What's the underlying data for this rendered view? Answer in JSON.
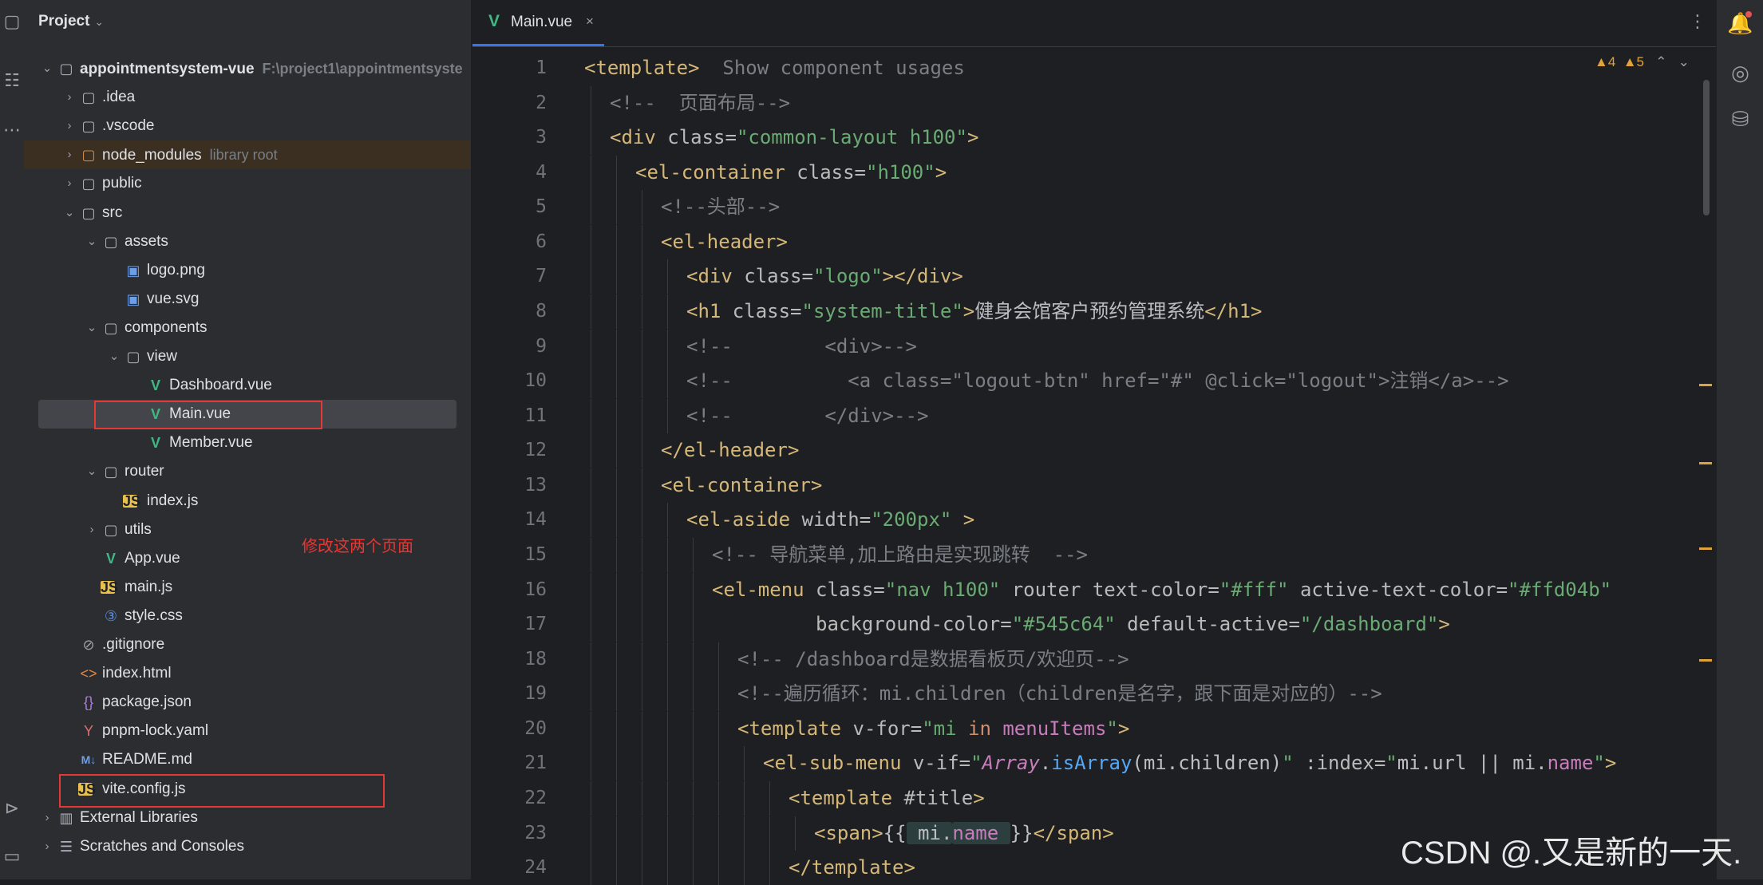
{
  "left_strip": {
    "icons": [
      {
        "name": "project-panel-icon",
        "glyph": "▢"
      },
      {
        "name": "structure-icon",
        "glyph": "☷"
      },
      {
        "name": "more-icon",
        "glyph": "⋯"
      },
      {
        "name": "services-icon",
        "glyph": "⊳"
      },
      {
        "name": "terminal-icon",
        "glyph": "▭"
      }
    ]
  },
  "project": {
    "title": "Project",
    "chevron": "⌄",
    "rows": [
      {
        "arrow": "⌄",
        "icon": "▢",
        "icon_class": "i-folder",
        "label": "appointmentsystem-vue",
        "hint": "F:\\project1\\appointmentsyste",
        "bold": true
      },
      {
        "arrow": "›",
        "icon": "▢",
        "icon_class": "i-folder",
        "label": ".idea"
      },
      {
        "arrow": "›",
        "icon": "▢",
        "icon_class": "i-folder",
        "label": ".vscode"
      },
      {
        "arrow": "›",
        "icon": "▢",
        "icon_class": "i-folder-orange",
        "label": "node_modules",
        "hint": "library root",
        "lib": true
      },
      {
        "arrow": "›",
        "icon": "▢",
        "icon_class": "i-folder",
        "label": "public"
      },
      {
        "arrow": "⌄",
        "icon": "▢",
        "icon_class": "i-folder",
        "label": "src"
      },
      {
        "arrow": "⌄",
        "icon": "▢",
        "icon_class": "i-folder",
        "label": "assets"
      },
      {
        "arrow": "",
        "icon": "▣",
        "icon_class": "i-img",
        "label": "logo.png"
      },
      {
        "arrow": "",
        "icon": "▣",
        "icon_class": "i-img",
        "label": "vue.svg"
      },
      {
        "arrow": "⌄",
        "icon": "▢",
        "icon_class": "i-folder",
        "label": "components"
      },
      {
        "arrow": "⌄",
        "icon": "▢",
        "icon_class": "i-folder",
        "label": "view"
      },
      {
        "arrow": "",
        "icon": "V",
        "icon_class": "i-vue",
        "label": "Dashboard.vue"
      },
      {
        "arrow": "",
        "icon": "V",
        "icon_class": "i-vue",
        "label": "Main.vue",
        "selected": true
      },
      {
        "arrow": "",
        "icon": "V",
        "icon_class": "i-vue",
        "label": "Member.vue"
      },
      {
        "arrow": "⌄",
        "icon": "▢",
        "icon_class": "i-folder",
        "label": "router"
      },
      {
        "arrow": "",
        "icon": "JS",
        "icon_class": "i-js",
        "label": "index.js"
      },
      {
        "arrow": "›",
        "icon": "▢",
        "icon_class": "i-folder",
        "label": "utils"
      },
      {
        "arrow": "",
        "icon": "V",
        "icon_class": "i-vue",
        "label": "App.vue"
      },
      {
        "arrow": "",
        "icon": "JS",
        "icon_class": "i-js",
        "label": "main.js"
      },
      {
        "arrow": "",
        "icon": "③",
        "icon_class": "i-css",
        "label": "style.css"
      },
      {
        "arrow": "",
        "icon": "⊘",
        "icon_class": "i-ignore",
        "label": ".gitignore"
      },
      {
        "arrow": "",
        "icon": "<>",
        "icon_class": "i-html",
        "label": "index.html"
      },
      {
        "arrow": "",
        "icon": "{}",
        "icon_class": "i-json",
        "label": "package.json"
      },
      {
        "arrow": "",
        "icon": "Y",
        "icon_class": "i-yaml",
        "label": "pnpm-lock.yaml"
      },
      {
        "arrow": "",
        "icon": "M↓",
        "icon_class": "i-md",
        "label": "README.md"
      },
      {
        "arrow": "",
        "icon": "JS",
        "icon_class": "i-js",
        "label": "vite.config.js"
      },
      {
        "arrow": "›",
        "icon": "▥",
        "icon_class": "i-lib",
        "label": "External Libraries"
      },
      {
        "arrow": "›",
        "icon": "☰",
        "icon_class": "i-scratch",
        "label": "Scratches and Consoles"
      }
    ],
    "annotation": "修改这两个页面"
  },
  "editor": {
    "tab": {
      "label": "Main.vue",
      "icon": "V",
      "close": "×"
    },
    "more": "⋮",
    "inspections": {
      "warn1": "▲4",
      "warn2": "▲5",
      "up": "⌃",
      "down": "⌄"
    },
    "lines": [
      {
        "n": "1",
        "indent": 0,
        "tokens": [
          [
            "c-tag",
            "<template>"
          ],
          [
            "c-com",
            "  Show component usages"
          ]
        ]
      },
      {
        "n": "2",
        "indent": 1,
        "tokens": [
          [
            "c-com",
            "<!--  页面布局-->"
          ]
        ]
      },
      {
        "n": "3",
        "indent": 1,
        "tokens": [
          [
            "c-tag",
            "<div "
          ],
          [
            "c-attr",
            "class="
          ],
          [
            "c-str",
            "\"common-layout h100\""
          ],
          [
            "c-tag",
            ">"
          ]
        ]
      },
      {
        "n": "4",
        "indent": 2,
        "tokens": [
          [
            "c-tag",
            "<el-container "
          ],
          [
            "c-attr",
            "class="
          ],
          [
            "c-str",
            "\"h100\""
          ],
          [
            "c-tag",
            ">"
          ]
        ]
      },
      {
        "n": "5",
        "indent": 3,
        "tokens": [
          [
            "c-com",
            "<!--头部-->"
          ]
        ]
      },
      {
        "n": "6",
        "indent": 3,
        "tokens": [
          [
            "c-tag",
            "<el-header>"
          ]
        ]
      },
      {
        "n": "7",
        "indent": 4,
        "tokens": [
          [
            "c-tag",
            "<div "
          ],
          [
            "c-attr",
            "class="
          ],
          [
            "c-str",
            "\"logo\""
          ],
          [
            "c-tag",
            "></div>"
          ]
        ]
      },
      {
        "n": "8",
        "indent": 4,
        "tokens": [
          [
            "c-tag",
            "<h1 "
          ],
          [
            "c-attr",
            "class="
          ],
          [
            "c-str",
            "\"system-title\""
          ],
          [
            "c-tag",
            ">"
          ],
          [
            "c-text",
            "健身会馆客户预约管理系统"
          ],
          [
            "c-tag",
            "</h1>"
          ]
        ]
      },
      {
        "n": "9",
        "indent": 4,
        "tokens": [
          [
            "c-com",
            "<!--        <div>-->"
          ]
        ]
      },
      {
        "n": "10",
        "indent": 4,
        "tokens": [
          [
            "c-com",
            "<!--          <a class=\"logout-btn\" href=\"#\" @click=\"logout\">注销</a>-->"
          ]
        ]
      },
      {
        "n": "11",
        "indent": 4,
        "tokens": [
          [
            "c-com",
            "<!--        </div>-->"
          ]
        ]
      },
      {
        "n": "12",
        "indent": 3,
        "tokens": [
          [
            "c-tag",
            "</el-header>"
          ]
        ]
      },
      {
        "n": "13",
        "indent": 3,
        "tokens": [
          [
            "c-tag",
            "<el-container>"
          ]
        ]
      },
      {
        "n": "14",
        "indent": 4,
        "tokens": [
          [
            "c-tag",
            "<el-aside "
          ],
          [
            "c-attr",
            "width="
          ],
          [
            "c-str",
            "\"200px\""
          ],
          [
            "c-tag",
            " >"
          ]
        ]
      },
      {
        "n": "15",
        "indent": 5,
        "tokens": [
          [
            "c-com",
            "<!-- 导航菜单,加上路由是实现跳转  -->"
          ]
        ]
      },
      {
        "n": "16",
        "indent": 5,
        "tokens": [
          [
            "c-tag",
            "<el-menu "
          ],
          [
            "c-attr",
            "class="
          ],
          [
            "c-str",
            "\"nav h100\""
          ],
          [
            "c-attr",
            " router text-color="
          ],
          [
            "c-str",
            "\"#fff\""
          ],
          [
            "c-attr",
            " active-text-color="
          ],
          [
            "c-str",
            "\"#ffd04b\""
          ]
        ]
      },
      {
        "n": "17",
        "indent": 5,
        "tokens": [
          [
            "c-attr",
            "         background-color="
          ],
          [
            "c-str",
            "\"#545c64\""
          ],
          [
            "c-attr",
            " default-active="
          ],
          [
            "c-str",
            "\"/dashboard\""
          ],
          [
            "c-tag",
            ">"
          ]
        ]
      },
      {
        "n": "18",
        "indent": 6,
        "tokens": [
          [
            "c-com",
            "<!-- /dashboard是数据看板页/欢迎页-->"
          ]
        ]
      },
      {
        "n": "19",
        "indent": 6,
        "tokens": [
          [
            "c-com",
            "<!--遍历循环：mi.children（children是名字，跟下面是对应的）-->"
          ]
        ]
      },
      {
        "n": "20",
        "indent": 6,
        "tokens": [
          [
            "c-tag",
            "<template "
          ],
          [
            "c-attr",
            "v-for="
          ],
          [
            "c-str",
            "\"mi "
          ],
          [
            "c-kw",
            "in"
          ],
          [
            "c-str",
            " "
          ],
          [
            "c-purple",
            "menuItems"
          ],
          [
            "c-str",
            "\""
          ],
          [
            "c-tag",
            ">"
          ]
        ]
      },
      {
        "n": "21",
        "indent": 7,
        "tokens": [
          [
            "c-tag",
            "<el-sub-menu "
          ],
          [
            "c-attr",
            "v-if="
          ],
          [
            "c-str",
            "\""
          ],
          [
            "c-it",
            "Array"
          ],
          [
            "c-text",
            "."
          ],
          [
            "c-fn",
            "isArray"
          ],
          [
            "c-text",
            "(mi.children)"
          ],
          [
            "c-str",
            "\""
          ],
          [
            "c-attr",
            " :index="
          ],
          [
            "c-str",
            "\""
          ],
          [
            "c-text",
            "mi.url || mi."
          ],
          [
            "c-purple",
            "name"
          ],
          [
            "c-str",
            "\""
          ],
          [
            "c-tag",
            ">"
          ]
        ]
      },
      {
        "n": "22",
        "indent": 8,
        "tokens": [
          [
            "c-tag",
            "<template "
          ],
          [
            "c-attr",
            "#title"
          ],
          [
            "c-tag",
            ">"
          ]
        ]
      },
      {
        "n": "23",
        "indent": 9,
        "tokens": [
          [
            "c-tag",
            "<span>"
          ],
          [
            "c-text",
            "{{"
          ],
          [
            "c-hl",
            " mi."
          ],
          [
            "c-hl-purple",
            "name "
          ],
          [
            "c-text",
            "}}"
          ],
          [
            "c-tag",
            "</span>"
          ]
        ]
      },
      {
        "n": "24",
        "indent": 8,
        "tokens": [
          [
            "c-tag",
            "</template>"
          ]
        ]
      }
    ]
  },
  "right_strip": {
    "icons": [
      {
        "name": "notifications-icon",
        "glyph": "🔔"
      },
      {
        "name": "ai-assistant-icon",
        "glyph": "◎"
      },
      {
        "name": "database-icon",
        "glyph": "⛁"
      }
    ]
  },
  "watermark": "CSDN @.又是新的一天."
}
